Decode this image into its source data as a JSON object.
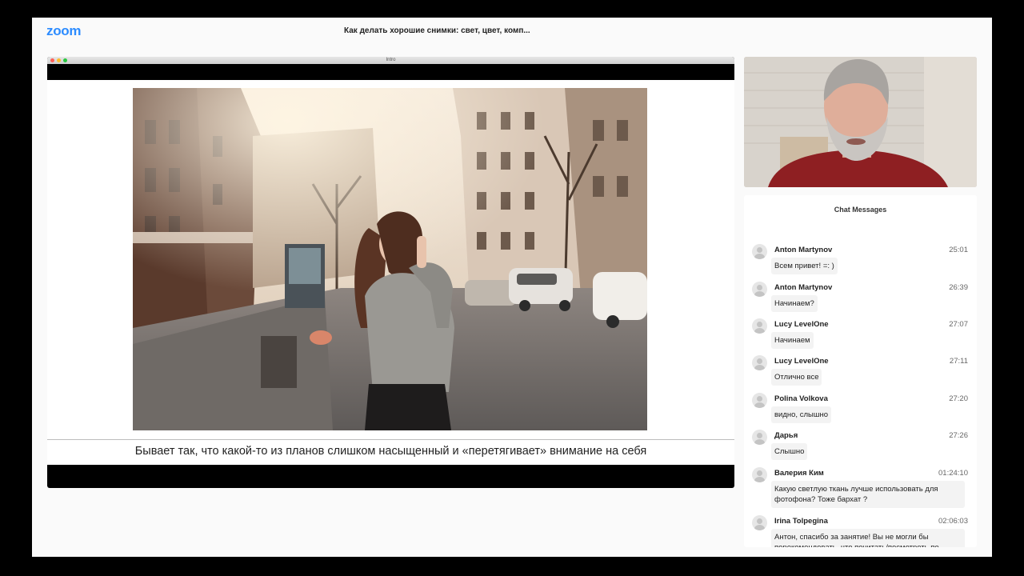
{
  "app": {
    "logo": "zoom",
    "meeting_title": "Как делать хорошие снимки: свет, цвет, комп..."
  },
  "share": {
    "window_title": "Intro",
    "caption": "Бывает так, что какой-то из планов слишком насыщенный и «перетягивает» внимание на себя"
  },
  "colors": {
    "brand": "#2d8cff",
    "background": "#fafafa"
  },
  "chat": {
    "title": "Chat Messages",
    "messages": [
      {
        "name": "Anton Martynov",
        "time": "25:01",
        "text": "Всем привет! =: )"
      },
      {
        "name": "Anton Martynov",
        "time": "26:39",
        "text": "Начинаем?"
      },
      {
        "name": "Lucy LevelOne",
        "time": "27:07",
        "text": "Начинаем"
      },
      {
        "name": "Lucy LevelOne",
        "time": "27:11",
        "text": "Отлично все"
      },
      {
        "name": "Polina Volkova",
        "time": "27:20",
        "text": "видно, слышно"
      },
      {
        "name": "Дарья",
        "time": "27:26",
        "text": "Слышно"
      },
      {
        "name": "Валерия Ким",
        "time": "01:24:10",
        "text": "Какую светлую ткань лучше использовать для фотофона? Тоже бархат ?"
      },
      {
        "name": "Irina Tolpegina",
        "time": "02:06:03",
        "text": "Антон, спасибо за занятие! Вы не могли бы порекомендовать, что почитать/посмотреть по"
      }
    ]
  }
}
